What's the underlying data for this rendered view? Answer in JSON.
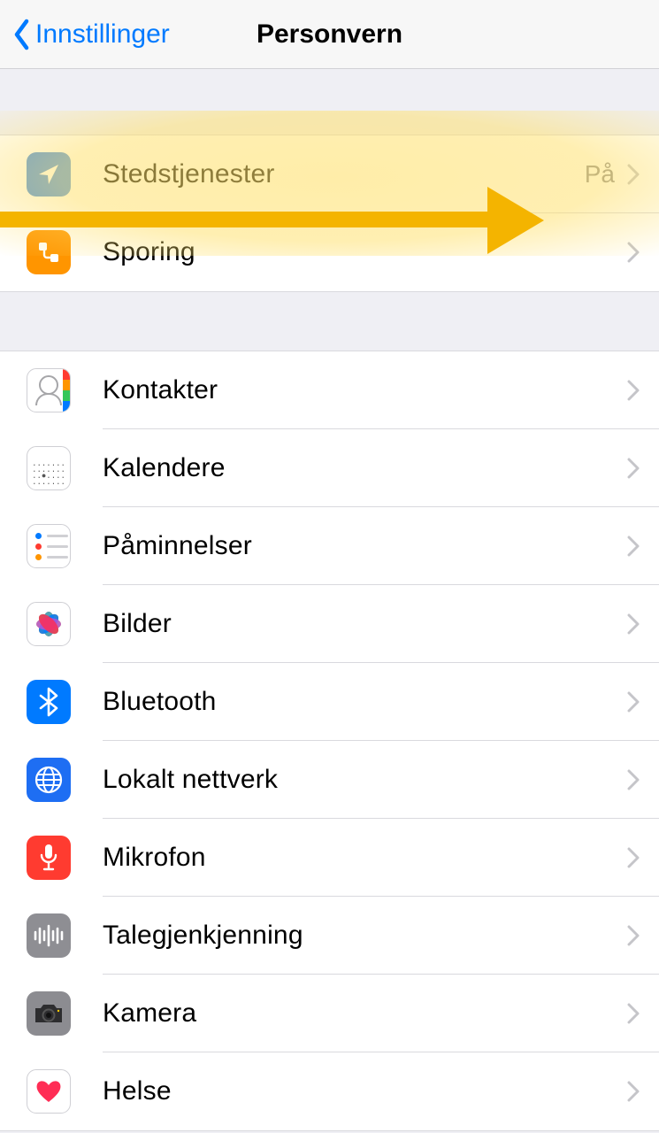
{
  "header": {
    "back_label": "Innstillinger",
    "title": "Personvern"
  },
  "section1": {
    "items": [
      {
        "id": "location",
        "label": "Stedstjenester",
        "value": "På"
      },
      {
        "id": "tracking",
        "label": "Sporing",
        "value": ""
      }
    ]
  },
  "section2": {
    "items": [
      {
        "id": "contacts",
        "label": "Kontakter"
      },
      {
        "id": "calendars",
        "label": "Kalendere"
      },
      {
        "id": "reminders",
        "label": "Påminnelser"
      },
      {
        "id": "photos",
        "label": "Bilder"
      },
      {
        "id": "bluetooth",
        "label": "Bluetooth"
      },
      {
        "id": "localnet",
        "label": "Lokalt nettverk"
      },
      {
        "id": "mic",
        "label": "Mikrofon"
      },
      {
        "id": "speech",
        "label": "Talegjenkjenning"
      },
      {
        "id": "camera",
        "label": "Kamera"
      },
      {
        "id": "health",
        "label": "Helse"
      }
    ]
  }
}
